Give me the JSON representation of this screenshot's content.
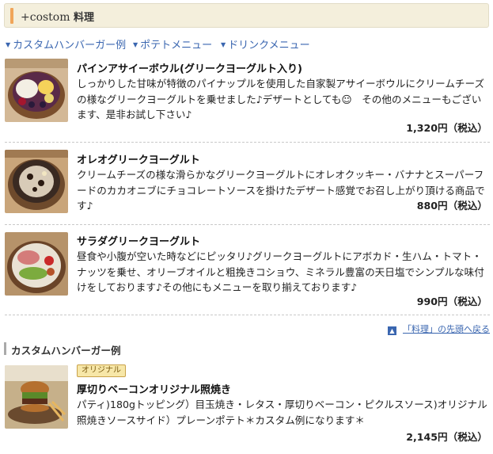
{
  "header": {
    "prefix": "+costom",
    "title": "料理"
  },
  "nav": [
    {
      "label": "カスタムハンバーガー例"
    },
    {
      "label": "ポテトメニュー"
    },
    {
      "label": "ドリンクメニュー"
    }
  ],
  "items": [
    {
      "name": "パインアサイーボウル(グリークヨーグルト入り)",
      "desc": "しっかりした甘味が特徴のパイナップルを使用した自家製アサイーボウルにクリームチーズの様なグリークヨーグルトを乗せました♪デザートとしても☺　その他のメニューもございます、是非お試し下さい♪",
      "price": "1,320円（税込）"
    },
    {
      "name": "オレオグリークヨーグルト",
      "desc": "クリームチーズの様な滑らかなグリークヨーグルトにオレオクッキー・バナナとスーパーフードのカカオニブにチョコレートソースを掛けたデザート感覚でお召し上がり頂ける商品です♪",
      "price": "880円（税込）"
    },
    {
      "name": "サラダグリークヨーグルト",
      "desc": "昼食や小腹が空いた時などにピッタリ♪グリークヨーグルトにアボカド・生ハム・トマト・ナッツを乗せ、オリーブオイルと粗挽きコショウ、ミネラル豊富の天日塩でシンプルな味付けをしております♪その他にもメニューを取り揃えております♪",
      "price": "990円（税込）"
    }
  ],
  "back_to_top": "「料理」の先頭へ戻る",
  "section2": {
    "title": "カスタムハンバーガー例",
    "badge": "オリジナル",
    "item": {
      "name": "厚切りベーコンオリジナル照焼き",
      "desc": "パティ)180gトッピング）目玉焼き・レタス・厚切りベーコン・ピクルスソース)オリジナル照焼きソースサイド）プレーンポテト＊カスタム例になります＊",
      "price": "2,145円（税込）"
    }
  }
}
